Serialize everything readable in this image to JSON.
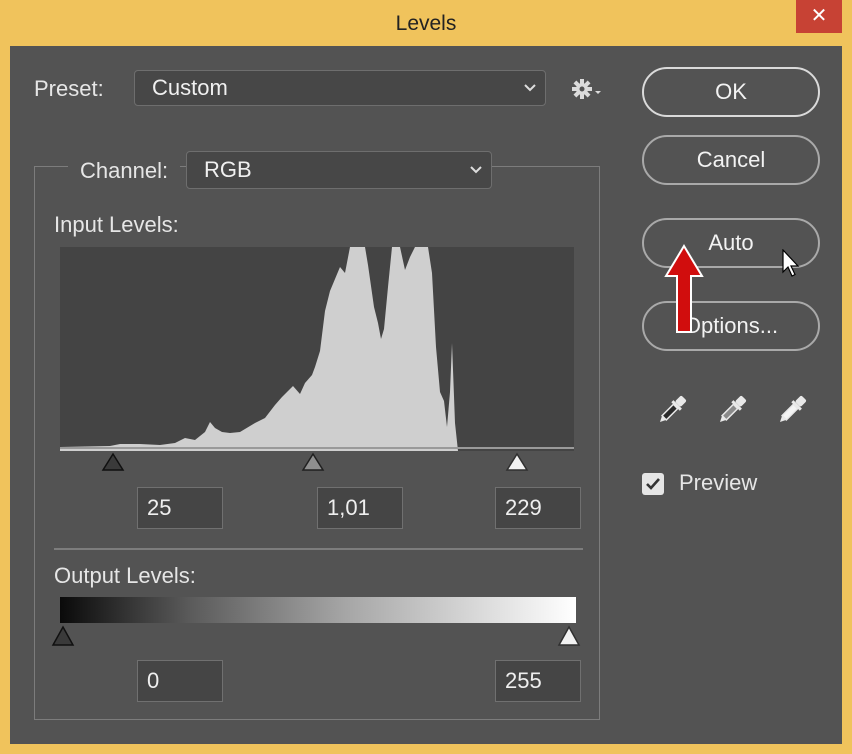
{
  "window": {
    "title": "Levels",
    "close_glyph": "✕"
  },
  "preset": {
    "label": "Preset:",
    "value": "Custom"
  },
  "icons": {
    "gear": "gear-icon",
    "dropdown": "chevron-down-icon",
    "eyedropper": "eyedropper-icon",
    "cursor": "cursor-icon",
    "arrow": "red-arrow-icon"
  },
  "channel": {
    "label": "Channel:",
    "value": "RGB"
  },
  "input_levels": {
    "label": "Input Levels:",
    "black": "25",
    "gamma": "1,01",
    "white": "229"
  },
  "output_levels": {
    "label": "Output Levels:",
    "black": "0",
    "white": "255"
  },
  "buttons": {
    "ok": "OK",
    "cancel": "Cancel",
    "auto": "Auto",
    "options": "Options..."
  },
  "preview": {
    "label": "Preview",
    "checked": true
  },
  "colors": {
    "dialog_bg": "#535353",
    "frame": "#f0c35c",
    "histogram_fill": "#cfcfcf",
    "arrow": "#d10d0d"
  }
}
